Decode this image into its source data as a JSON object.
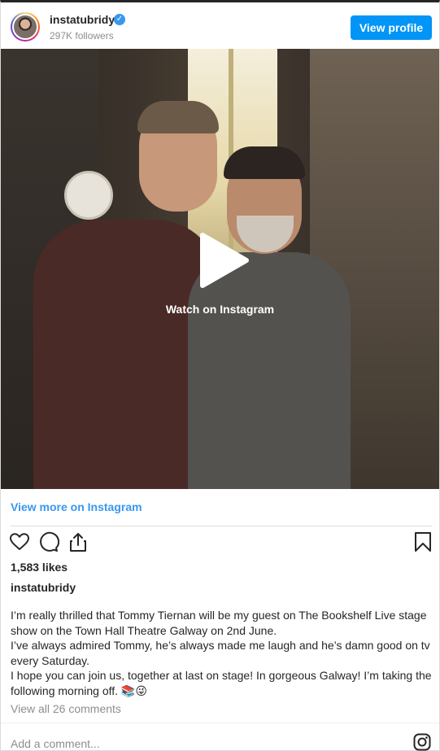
{
  "header": {
    "username": "instatubridy",
    "followers": "297K followers",
    "view_profile": "View profile",
    "verified_icon": "verified-badge-icon"
  },
  "media": {
    "watch_label": "Watch on Instagram",
    "play_icon": "play-icon"
  },
  "links": {
    "view_more": "View more on Instagram"
  },
  "actions": {
    "icons": [
      "heart-icon",
      "comment-icon",
      "share-icon",
      "bookmark-icon"
    ]
  },
  "post": {
    "likes": "1,583 likes",
    "caption_user": "instatubridy",
    "caption_lines": [
      "I’m really thrilled that Tommy Tiernan will be my guest on The Bookshelf Live stage show on the Town Hall Theatre Galway on 2nd June.",
      "I’ve always admired Tommy, he’s always made me laugh and he’s damn good on tv every Saturday.",
      "I hope you can join us, together at last on stage! In gorgeous Galway! I’m taking the following morning off. 📚😜"
    ],
    "view_comments": "View all 26 comments"
  },
  "comment_box": {
    "placeholder": "Add a comment...",
    "logo_icon": "instagram-logo-icon"
  },
  "colors": {
    "accent": "#0095f6",
    "link": "#3897f0",
    "muted": "#8e8e8e",
    "text": "#262626"
  }
}
